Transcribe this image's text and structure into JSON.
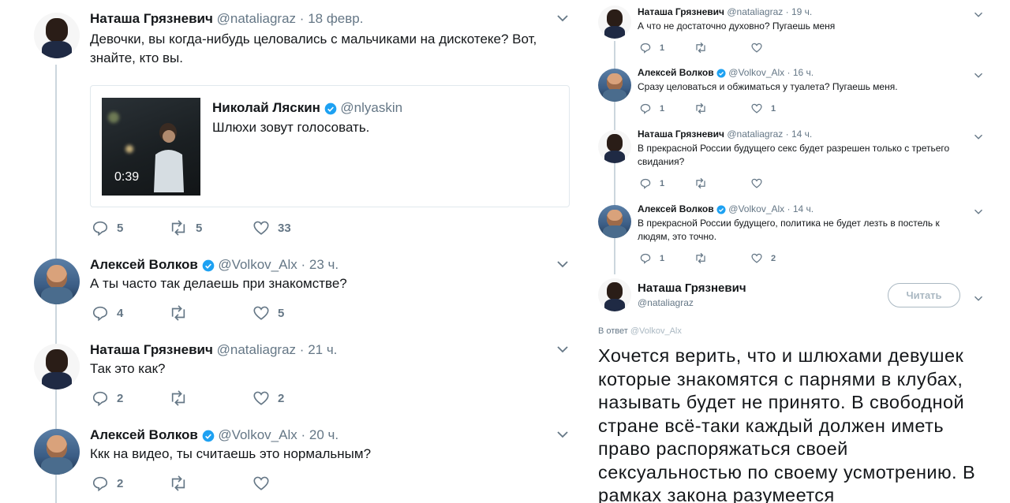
{
  "left": {
    "tweets": [
      {
        "name": "Наташа Грязневич",
        "handle": "@nataliagraz",
        "dot": "·",
        "time": "18 февр.",
        "text_line1": "Девочки, вы когда-нибудь целовались с мальчиками на дискотеке? Вот,",
        "text_line2": "знайте, кто вы.",
        "quote": {
          "name": "Николай Ляскин",
          "handle": "@nlyaskin",
          "text": "Шлюхи зовут голосовать.",
          "duration": "0:39"
        },
        "replies": "5",
        "retweets": "5",
        "likes": "33"
      },
      {
        "name": "Алексей Волков",
        "handle": "@Volkov_Alx",
        "dot": "·",
        "time": "23 ч.",
        "text": "А ты часто так делаешь при знакомстве?",
        "replies": "4",
        "retweets": "",
        "likes": "5"
      },
      {
        "name": "Наташа Грязневич",
        "handle": "@nataliagraz",
        "dot": "·",
        "time": "21 ч.",
        "text": "Так это как?",
        "replies": "2",
        "retweets": "",
        "likes": "2"
      },
      {
        "name": "Алексей Волков",
        "handle": "@Volkov_Alx",
        "dot": "·",
        "time": "20 ч.",
        "text": "Ккк на видео, ты считаешь это нормальным?",
        "replies": "2",
        "retweets": "",
        "likes": ""
      }
    ]
  },
  "right": {
    "tweets": [
      {
        "name": "Наташа Грязневич",
        "handle": "@nataliagraz",
        "dot": "·",
        "time": "19 ч.",
        "text_line1": "А что не достаточно духовно? Пугаешь меня",
        "text_line2": "",
        "replies": "1",
        "retweets": "",
        "likes": ""
      },
      {
        "name": "Алексей Волков",
        "handle": "@Volkov_Alx",
        "dot": "·",
        "time": "16 ч.",
        "text_line1": "Сразу целоваться и обжиматься у туалета? Пугаешь меня.",
        "text_line2": "",
        "replies": "1",
        "retweets": "",
        "likes": "1"
      },
      {
        "name": "Наташа Грязневич",
        "handle": "@nataliagraz",
        "dot": "·",
        "time": "14 ч.",
        "text_line1": "В прекрасной России будущего секс будет разрешен только с третьего",
        "text_line2": "свидания?",
        "replies": "1",
        "retweets": "",
        "likes": ""
      },
      {
        "name": "Алексей Волков",
        "handle": "@Volkov_Alx",
        "dot": "·",
        "time": "14 ч.",
        "text_line1": "В прекрасной России будущего, политика не будет лезть в постель к",
        "text_line2": "людям, это точно.",
        "replies": "1",
        "retweets": "",
        "likes": "2"
      }
    ],
    "focus": {
      "name": "Наташа Грязневич",
      "handle": "@nataliagraz",
      "follow_label": "Читать",
      "reply_to_prefix": "В ответ",
      "reply_to_handle": "@Volkov_Alx",
      "lines": [
        "Хочется верить, что и шлюхами девушек",
        "которые знакомятся с парнями в клубах,",
        "называть будет не принято. В свободной",
        "стране всё-таки каждый должен иметь",
        "право распоряжаться своей",
        "сексуальностью по своему усмотрению. В",
        "рамках закона разумеется"
      ]
    }
  },
  "colors": {
    "text": "#14171a",
    "secondary": "#657786",
    "verified": "#1da1f2",
    "divider": "#e6ecf0",
    "thread_line": "#ccd6dd"
  }
}
